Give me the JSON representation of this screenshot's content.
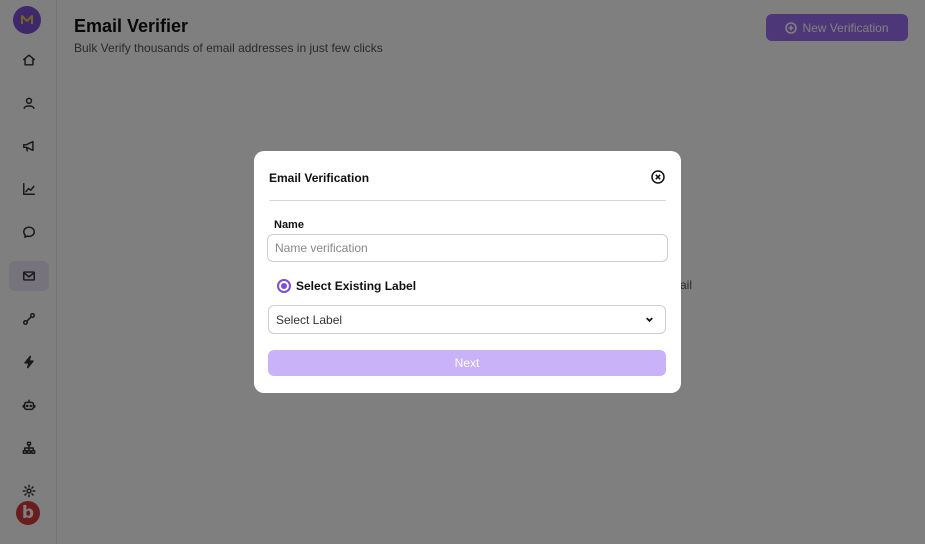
{
  "header": {
    "title": "Email Verifier",
    "subtitle": "Bulk Verify thousands of email addresses in just few clicks",
    "new_button_label": "New Verification"
  },
  "background_text_fragment": "ail",
  "sidebar": {
    "items": [
      {
        "name": "home",
        "icon": "home-icon"
      },
      {
        "name": "contacts",
        "icon": "user-icon"
      },
      {
        "name": "campaigns",
        "icon": "megaphone-icon"
      },
      {
        "name": "analytics",
        "icon": "chart-icon"
      },
      {
        "name": "inbox",
        "icon": "chat-icon"
      },
      {
        "name": "email-verifier",
        "icon": "mail-icon",
        "active": true
      },
      {
        "name": "integrations",
        "icon": "link-icon"
      },
      {
        "name": "automations",
        "icon": "bolt-icon"
      },
      {
        "name": "bots",
        "icon": "robot-icon"
      },
      {
        "name": "organization",
        "icon": "sitemap-icon"
      },
      {
        "name": "settings",
        "icon": "gear-icon"
      }
    ]
  },
  "modal": {
    "title": "Email Verification",
    "name_label": "Name",
    "name_placeholder": "Name verification",
    "name_value": "",
    "radio_label": "Select Existing Label",
    "select_value": "Select Label",
    "next_label": "Next"
  },
  "colors": {
    "accent": "#7c4fd6",
    "button_primary": "#9b6ff0",
    "button_disabled": "#c9b2f7",
    "overlay": "rgba(0,0,0,0.5)",
    "brand_badge": "#d23a3a"
  }
}
